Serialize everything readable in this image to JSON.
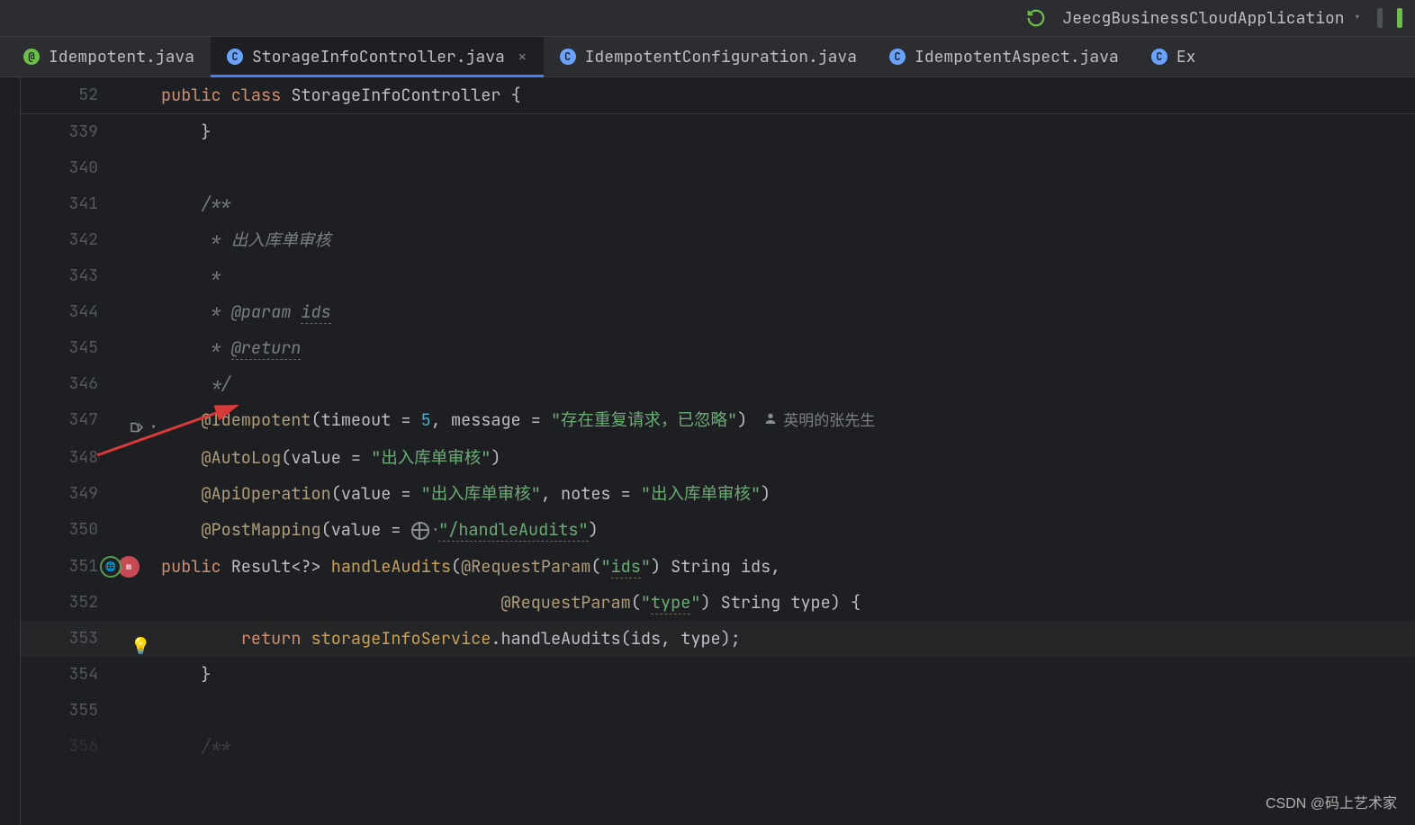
{
  "toolbar": {
    "run_config": "JeecgBusinessCloudApplication"
  },
  "tabs": [
    {
      "label": "Idempotent.java",
      "iconClass": "interface",
      "iconLetter": "@",
      "active": false,
      "closable": false,
      "extra": false
    },
    {
      "label": "StorageInfoController.java",
      "iconClass": "class",
      "iconLetter": "C",
      "active": true,
      "closable": true
    },
    {
      "label": "IdempotentConfiguration.java",
      "iconClass": "class",
      "iconLetter": "C",
      "active": false,
      "closable": false
    },
    {
      "label": "IdempotentAspect.java",
      "iconClass": "class",
      "iconLetter": "C",
      "active": false,
      "closable": false
    },
    {
      "label": "Ex",
      "iconClass": "class",
      "iconLetter": "C",
      "active": false,
      "closable": false,
      "truncated": true
    }
  ],
  "sticky": {
    "line": "52",
    "tokens": [
      {
        "t": "public ",
        "c": "k-kw"
      },
      {
        "t": "class ",
        "c": "k-kw"
      },
      {
        "t": "StorageInfoController {",
        "c": ""
      }
    ]
  },
  "rows": [
    {
      "n": "339",
      "tokens": [
        {
          "t": "    }",
          "c": ""
        }
      ]
    },
    {
      "n": "340",
      "tokens": [
        {
          "t": "",
          "c": ""
        }
      ]
    },
    {
      "n": "341",
      "tokens": [
        {
          "t": "    /**",
          "c": "k-cmt"
        }
      ]
    },
    {
      "n": "342",
      "tokens": [
        {
          "t": "     * 出入库单审核",
          "c": "k-cmt"
        }
      ]
    },
    {
      "n": "343",
      "tokens": [
        {
          "t": "     *",
          "c": "k-cmt"
        }
      ]
    },
    {
      "n": "344",
      "tokens": [
        {
          "t": "     * ",
          "c": "k-cmt"
        },
        {
          "t": "@param ",
          "c": "k-cmt"
        },
        {
          "t": "ids",
          "c": "k-cmt und"
        }
      ]
    },
    {
      "n": "345",
      "tokens": [
        {
          "t": "     * ",
          "c": "k-cmt"
        },
        {
          "t": "@return",
          "c": "k-cmt und"
        }
      ]
    },
    {
      "n": "346",
      "tokens": [
        {
          "t": "     */",
          "c": "k-cmt"
        }
      ]
    },
    {
      "n": "inlay",
      "inlay": true
    },
    {
      "n": "347",
      "author": "英明的张先生",
      "tokens": [
        {
          "t": "    ",
          "c": ""
        },
        {
          "t": "@Idempotent",
          "c": "k-anno"
        },
        {
          "t": "(",
          "c": ""
        },
        {
          "t": "timeout = ",
          "c": ""
        },
        {
          "t": "5",
          "c": "k-num"
        },
        {
          "t": ", message = ",
          "c": ""
        },
        {
          "t": "\"存在重复请求，已忽略\"",
          "c": "k-str"
        },
        {
          "t": ")",
          "c": ""
        }
      ]
    },
    {
      "n": "348",
      "tokens": [
        {
          "t": "    ",
          "c": ""
        },
        {
          "t": "@AutoLog",
          "c": "k-anno"
        },
        {
          "t": "(value = ",
          "c": ""
        },
        {
          "t": "\"出入库单审核\"",
          "c": "k-str"
        },
        {
          "t": ")",
          "c": ""
        }
      ]
    },
    {
      "n": "349",
      "tokens": [
        {
          "t": "    ",
          "c": ""
        },
        {
          "t": "@ApiOperation",
          "c": "k-anno"
        },
        {
          "t": "(value = ",
          "c": ""
        },
        {
          "t": "\"出入库单审核\"",
          "c": "k-str"
        },
        {
          "t": ", notes = ",
          "c": ""
        },
        {
          "t": "\"出入库单审核\"",
          "c": "k-str"
        },
        {
          "t": ")",
          "c": ""
        }
      ]
    },
    {
      "n": "350",
      "tokens": [
        {
          "t": "    ",
          "c": ""
        },
        {
          "t": "@PostMapping",
          "c": "k-anno"
        },
        {
          "t": "(value = ",
          "c": ""
        },
        {
          "t": "GLOBE",
          "c": "globe"
        },
        {
          "t": "\"/handleAudits\"",
          "c": "k-str und"
        },
        {
          "t": ")",
          "c": ""
        }
      ]
    },
    {
      "n": "351",
      "gutter": "mapping",
      "tokens": [
        {
          "t": "",
          "c": ""
        },
        {
          "t": "public ",
          "c": "k-kw"
        },
        {
          "t": "Result<?> ",
          "c": ""
        },
        {
          "t": "handleAudits",
          "c": "k-meth"
        },
        {
          "t": "(",
          "c": ""
        },
        {
          "t": "@RequestParam",
          "c": "k-anno"
        },
        {
          "t": "(",
          "c": ""
        },
        {
          "t": "\"",
          "c": "k-str"
        },
        {
          "t": "ids",
          "c": "k-str und"
        },
        {
          "t": "\"",
          "c": "k-str"
        },
        {
          "t": ") String ids,",
          "c": ""
        }
      ]
    },
    {
      "n": "352",
      "tokens": [
        {
          "t": "                                  ",
          "c": ""
        },
        {
          "t": "@RequestParam",
          "c": "k-anno"
        },
        {
          "t": "(",
          "c": ""
        },
        {
          "t": "\"",
          "c": "k-str"
        },
        {
          "t": "type",
          "c": "k-str und"
        },
        {
          "t": "\"",
          "c": "k-str"
        },
        {
          "t": ") String type) {",
          "c": ""
        }
      ]
    },
    {
      "n": "353",
      "gutter": "bulb",
      "hi": true,
      "tokens": [
        {
          "t": "        ",
          "c": ""
        },
        {
          "t": "return ",
          "c": "k-kw"
        },
        {
          "t": "storageInfoService",
          "c": "k-meth"
        },
        {
          "t": ".",
          "c": ""
        },
        {
          "t": "handleAudits",
          "c": ""
        },
        {
          "t": "(ids, type);",
          "c": ""
        }
      ]
    },
    {
      "n": "354",
      "tokens": [
        {
          "t": "    }",
          "c": ""
        }
      ]
    },
    {
      "n": "355",
      "tokens": [
        {
          "t": "",
          "c": ""
        }
      ]
    },
    {
      "n": "356",
      "faded": true,
      "tokens": [
        {
          "t": "    /**",
          "c": "k-cmt"
        }
      ]
    }
  ],
  "watermark": "CSDN @码上艺术家"
}
